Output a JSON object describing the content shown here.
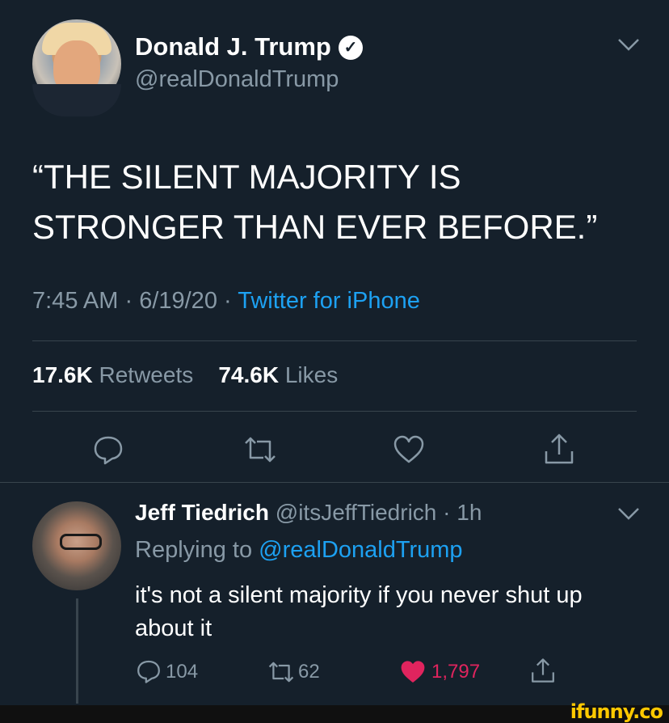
{
  "tweet": {
    "author_name": "Donald J. Trump",
    "author_handle": "@realDonaldTrump",
    "verified_glyph": "✓",
    "text": "“THE SILENT MAJORITY IS STRONGER THAN EVER BEFORE.”",
    "time": "7:45 AM",
    "date": "6/19/20",
    "separator": " · ",
    "source": "Twitter for iPhone",
    "retweets_count": "17.6K",
    "retweets_label": "Retweets",
    "likes_count": "74.6K",
    "likes_label": "Likes"
  },
  "reply": {
    "author_name": "Jeff Tiedrich",
    "author_handle": "@itsJeffTiedrich",
    "age": "· 1h",
    "replying_prefix": "Replying to",
    "replying_to": "@realDonaldTrump",
    "text": "it's not a silent majority if you never shut up about it",
    "reply_count": "104",
    "retweet_count": "62",
    "like_count": "1,797"
  },
  "watermark": "ifunny.co",
  "colors": {
    "background": "#15202b",
    "secondary_text": "#8899a6",
    "link": "#1da1f2",
    "like": "#e0245e",
    "divider": "#38444d"
  },
  "icons": [
    "chevron-down-icon",
    "verified-badge-icon",
    "reply-icon",
    "retweet-icon",
    "like-icon",
    "share-icon"
  ]
}
